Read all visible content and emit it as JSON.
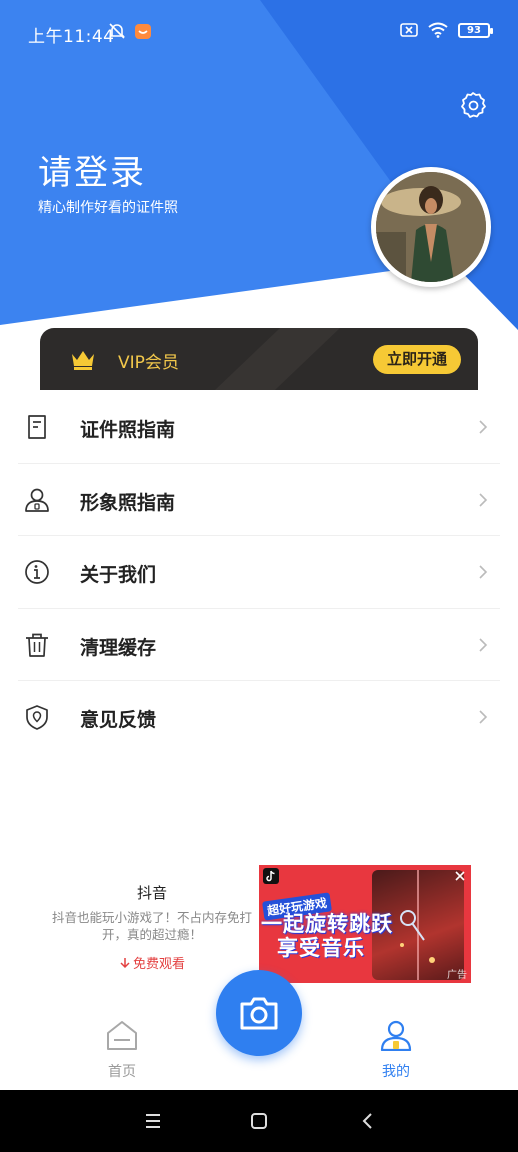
{
  "status_bar": {
    "time": "上午11:44",
    "battery": "93"
  },
  "header": {
    "login_title": "请登录",
    "login_subtitle": "精心制作好看的证件照"
  },
  "vip": {
    "label": "VIP会员",
    "button": "立即开通"
  },
  "menu": {
    "items": [
      {
        "label": "证件照指南",
        "icon": "document-icon"
      },
      {
        "label": "形象照指南",
        "icon": "person-icon"
      },
      {
        "label": "关于我们",
        "icon": "info-icon"
      },
      {
        "label": "清理缓存",
        "icon": "trash-icon"
      },
      {
        "label": "意见反馈",
        "icon": "shield-location-icon"
      }
    ]
  },
  "ad": {
    "app_name": "抖音",
    "description": "抖音也能玩小游戏了！不占内存免打开，真的超过瘾！",
    "cta": "免费观看",
    "banner_tagline": "超好玩游戏",
    "banner_line1": "一起旋转跳跃",
    "banner_line2": "享受音乐",
    "banner_tag": "广告"
  },
  "tabbar": {
    "home": "首页",
    "mine": "我的"
  },
  "colors": {
    "primary_blue": "#2f7ff0",
    "vip_gold": "#f6c935",
    "vip_dark": "#2d2b2a"
  }
}
